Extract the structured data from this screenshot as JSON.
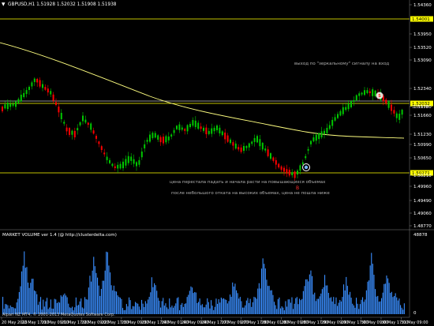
{
  "symbol_header": "GBPUSD,H1  1.51928 1.52032 1.51908 1.51938",
  "annotations": {
    "mirror_exit": "выход по \"зеркальному\" сигналу на вход",
    "b_marker": "B",
    "s_marker": "S",
    "price_stopped": "цена перестала падать и начала расти на повышающихся объемах",
    "after_pullback": "после небольшого отката на высоких объемах, цена не пошла ниже"
  },
  "price_axis": {
    "ticks": [
      "1.54360",
      "1.53950",
      "1.53520",
      "1.53090",
      "1.52340",
      "1.51780",
      "1.51660",
      "1.51230",
      "1.50990",
      "1.50650",
      "1.50210",
      "1.49960",
      "1.49490",
      "1.49060",
      "1.48770"
    ],
    "hline_labels": {
      "upper": "1.54001",
      "middle": "1.52032",
      "lower": "1.50271"
    },
    "current_price": "1.51938"
  },
  "volume_panel": {
    "title": "MARKET VOLUME ver 1.4 (@ http://clusterdelta.com)",
    "max_label": "48878",
    "zero_label": "0",
    "watermark": "Alpari NZ MT4, © 2001-2013 MetaQuotes Software Corp."
  },
  "time_axis": [
    "20 May 2013",
    "20 May 17:00",
    "21 May 09:00",
    "21 May 17:00",
    "22 May 09:00",
    "22 May 17:00",
    "23 May 09:00",
    "23 May 17:00",
    "24 May 01:00",
    "24 May 09:00",
    "24 May 17:00",
    "27 May 09:00",
    "27 May 17:00",
    "28 May 01:00",
    "28 May 09:00",
    "28 May 17:00",
    "29 May 09:00",
    "29 May 17:00",
    "30 May 09:00",
    "30 May 17:00",
    "31 May 09:00"
  ],
  "colors": {
    "background": "#000000",
    "bull": "#00c800",
    "bear": "#ff0000",
    "ma": "#ffff80",
    "hline": "#ffff00",
    "volume": "#3a8eff",
    "selected_hline": "#c0c0c0"
  }
}
